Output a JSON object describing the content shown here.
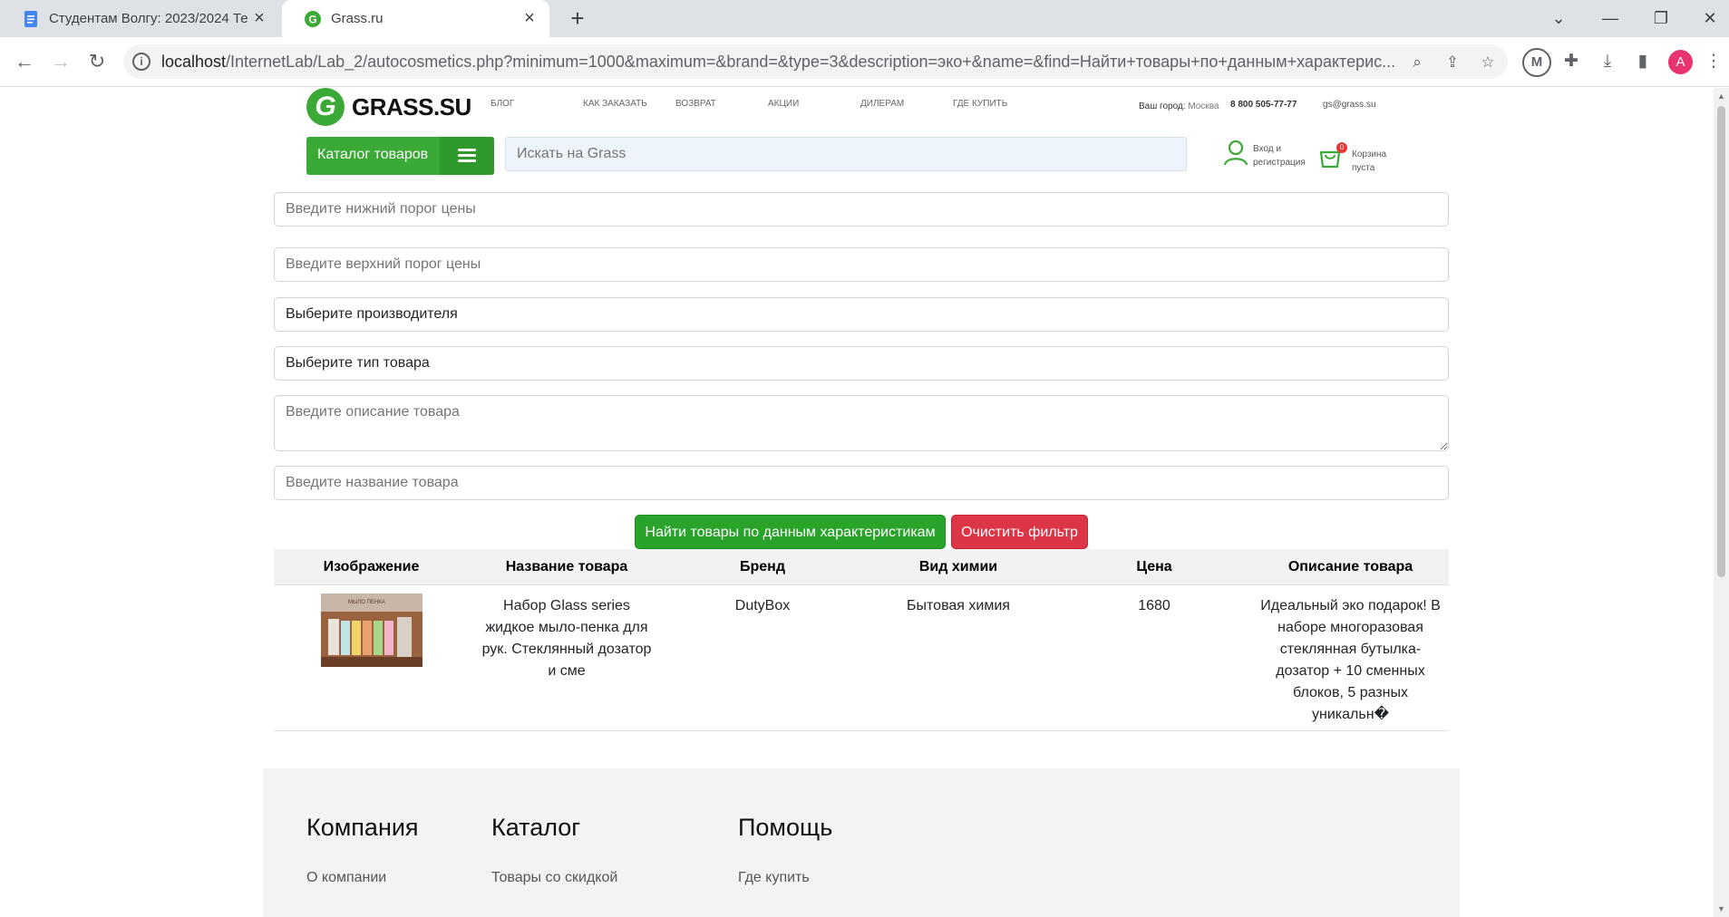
{
  "browser": {
    "tabs": [
      {
        "title": "Студентам Волгу: 2023/2024 Те",
        "active": false,
        "icon": "google-docs-icon"
      },
      {
        "title": "Grass.ru",
        "active": true,
        "icon": "grass-favicon"
      }
    ],
    "url_host": "localhost",
    "url_rest": "/InternetLab/Lab_2/autocosmetics.php?minimum=1000&maximum=&brand=&type=3&description=эко+&name=&find=Найти+товары+по+данным+характерис...",
    "profile_initial": "A",
    "new_tab_glyph": "+"
  },
  "site": {
    "logo_text": "GRASS.SU",
    "logo_mark": "G",
    "nav": [
      "БЛОГ",
      "КАК ЗАКАЗАТЬ",
      "ВОЗВРАТ",
      "АКЦИИ",
      "ДИЛЕРАМ",
      "ГДЕ КУПИТЬ"
    ],
    "city_label": "Ваш город:",
    "city_value": "Москва",
    "phone": "8 800 505-77-77",
    "email": "gs@grass.su",
    "catalog_button": "Каталог товаров",
    "search_placeholder": "Искать на Grass",
    "login_text": "Вход и регистрация",
    "cart_text": "Корзина пуста",
    "cart_count": "0",
    "brand_color": "#3aa935"
  },
  "filter": {
    "min_price_placeholder": "Введите нижний порог цены",
    "max_price_placeholder": "Введите верхний порог цены",
    "brand_select": "Выберите производителя",
    "type_select": "Выберите тип товара",
    "description_placeholder": "Введите описание товара",
    "name_placeholder": "Введите название товара",
    "find_button": "Найти товары по данным характеристикам",
    "clear_button": "Очистить фильтр"
  },
  "table": {
    "headers": [
      "Изображение",
      "Название товара",
      "Бренд",
      "Вид химии",
      "Цена",
      "Описание товара"
    ],
    "rows": [
      {
        "name": "Набор Glass series жидкое мыло-пенка для рук. Стеклянный дозатор и сме",
        "brand": "DutyBox",
        "type": "Бытовая химия",
        "price": "1680",
        "description": "Идеальный эко подарок! В наборе многоразовая стеклянная бутылка-дозатор + 10 сменных блоков, 5 разных уникальн�",
        "image_caption": "МЫЛО ПЕНКА"
      }
    ]
  },
  "footer": {
    "columns": [
      {
        "heading": "Компания",
        "link": "О компании"
      },
      {
        "heading": "Каталог",
        "link": "Товары со скидкой"
      },
      {
        "heading": "Помощь",
        "link": "Где купить"
      }
    ]
  }
}
